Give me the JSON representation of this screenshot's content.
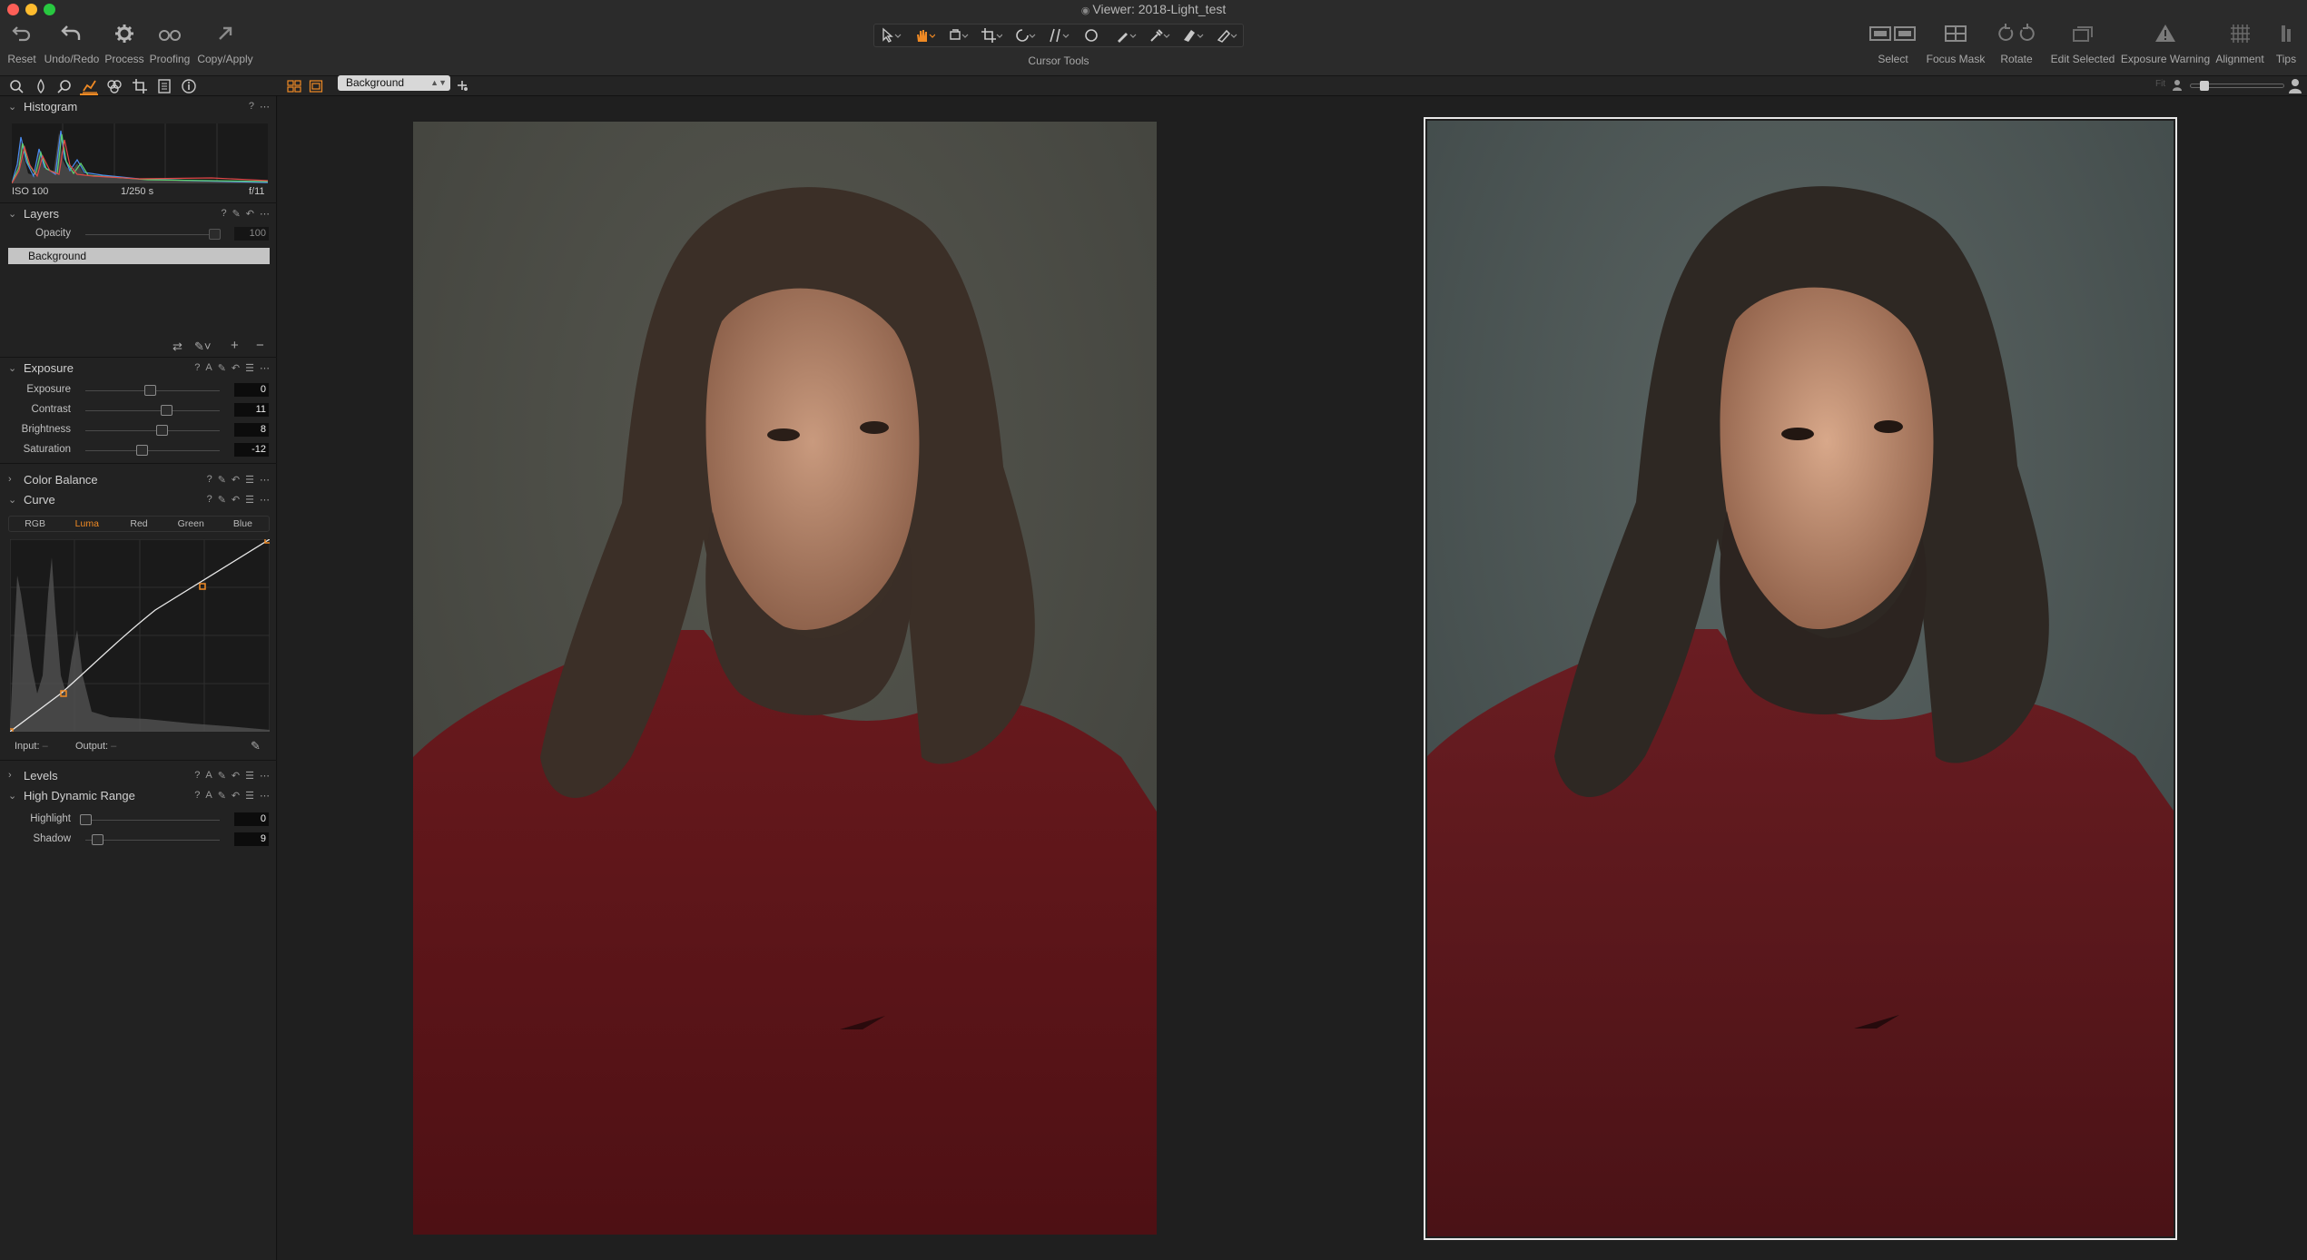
{
  "window": {
    "title": "Viewer: 2018-Light_test"
  },
  "toolbar": {
    "left_buttons": [
      {
        "label": "Reset",
        "icon": "reset-icon"
      },
      {
        "label": "Undo/Redo",
        "icon": "undo-icon"
      },
      {
        "label": "Process",
        "icon": "gear-icon"
      },
      {
        "label": "Proofing",
        "icon": "glasses-icon"
      },
      {
        "label": "Copy/Apply",
        "icon": "copy-apply-arrow-icon"
      }
    ],
    "cursor_tools_label": "Cursor Tools",
    "right_buttons": [
      {
        "label": "Select",
        "icon": "select-icon"
      },
      {
        "label": "Focus Mask",
        "icon": "focus-mask-icon"
      },
      {
        "label": "Rotate",
        "icon": "rotate-icon"
      },
      {
        "label": "Edit Selected",
        "icon": "edit-selected-icon"
      },
      {
        "label": "Exposure Warning",
        "icon": "warning-triangle-icon"
      },
      {
        "label": "Alignment",
        "icon": "grid-icon"
      },
      {
        "label": "Tips",
        "icon": "tips-icon"
      }
    ]
  },
  "subbar": {
    "layer_selected": "Background",
    "fit_label": "Fit"
  },
  "histogram": {
    "title": "Histogram",
    "iso": "ISO 100",
    "shutter": "1/250 s",
    "aperture": "f/11"
  },
  "layers": {
    "title": "Layers",
    "opacity_label": "Opacity",
    "opacity_value": "100",
    "items": [
      "Background"
    ]
  },
  "exposure": {
    "title": "Exposure",
    "sliders": [
      {
        "label": "Exposure",
        "value": "0",
        "position": 0.48
      },
      {
        "label": "Contrast",
        "value": "11",
        "position": 0.6
      },
      {
        "label": "Brightness",
        "value": "8",
        "position": 0.57
      },
      {
        "label": "Saturation",
        "value": "-12",
        "position": 0.42
      }
    ]
  },
  "color_balance": {
    "title": "Color Balance"
  },
  "curve": {
    "title": "Curve",
    "tabs": [
      "RGB",
      "Luma",
      "Red",
      "Green",
      "Blue"
    ],
    "active_tab": "Luma",
    "input_label": "Input:",
    "output_label": "Output:",
    "input_value": "–",
    "output_value": "–"
  },
  "levels": {
    "title": "Levels"
  },
  "hdr": {
    "title": "High Dynamic Range",
    "sliders": [
      {
        "label": "Highlight",
        "value": "0",
        "position": 0.0
      },
      {
        "label": "Shadow",
        "value": "9",
        "position": 0.09
      }
    ]
  },
  "colors": {
    "accent": "#f08a24",
    "panel_bg": "#222222",
    "viewer_bg": "#1f1f1f",
    "shirt_red": "#6e1a20"
  }
}
